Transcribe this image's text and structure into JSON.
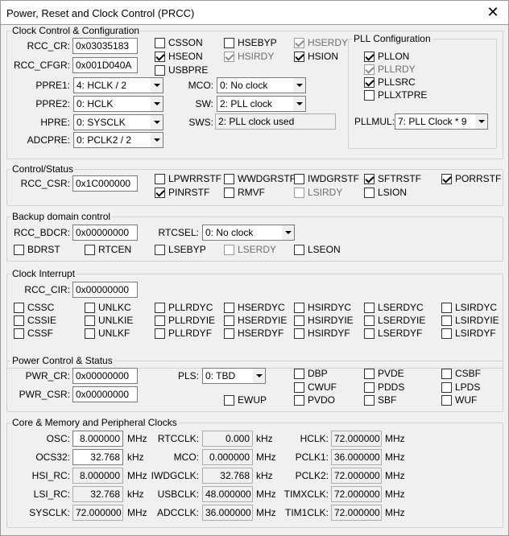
{
  "window": {
    "title": "Power, Reset and Clock Control (PRCC)",
    "close_glyph": "✕"
  },
  "ccc": {
    "legend": "Clock Control & Configuration",
    "rcc_cr_label": "RCC_CR:",
    "rcc_cr": "0x03035183",
    "rcc_cfgr_label": "RCC_CFGR:",
    "rcc_cfgr": "0x001D040A",
    "ppre1_label": "PPRE1:",
    "ppre1": "4: HCLK / 2",
    "ppre2_label": "PPRE2:",
    "ppre2": "0: HCLK",
    "hpre_label": "HPRE:",
    "hpre": "0: SYSCLK",
    "adcpre_label": "ADCPRE:",
    "adcpre": "0: PCLK2 / 2",
    "mco_label": "MCO:",
    "mco": "0: No clock",
    "sw_label": "SW:",
    "sw": "2: PLL clock",
    "sws_label": "SWS:",
    "sws": "2: PLL clock used",
    "checks": [
      {
        "label": "CSSON",
        "checked": false,
        "disabled": false
      },
      {
        "label": "HSEBYP",
        "checked": false,
        "disabled": false
      },
      {
        "label": "HSERDY",
        "checked": true,
        "disabled": true
      },
      {
        "label": "HSEON",
        "checked": true,
        "disabled": false
      },
      {
        "label": "HSIRDY",
        "checked": true,
        "disabled": true
      },
      {
        "label": "HSION",
        "checked": true,
        "disabled": false
      },
      {
        "label": "USBPRE",
        "checked": false,
        "disabled": false
      }
    ],
    "pll": {
      "legend": "PLL Configuration",
      "checks": [
        {
          "label": "PLLON",
          "checked": true,
          "disabled": false
        },
        {
          "label": "PLLRDY",
          "checked": true,
          "disabled": true
        },
        {
          "label": "PLLSRC",
          "checked": true,
          "disabled": false
        },
        {
          "label": "PLLXTPRE",
          "checked": false,
          "disabled": false
        }
      ],
      "pllmul_label": "PLLMUL:",
      "pllmul": "7: PLL Clock * 9"
    }
  },
  "cs": {
    "legend": "Control/Status",
    "rcc_csr_label": "RCC_CSR:",
    "rcc_csr": "0x1C000000",
    "checks": [
      {
        "label": "LPWRRSTF",
        "checked": false,
        "disabled": false
      },
      {
        "label": "WWDGRSTF",
        "checked": false,
        "disabled": false
      },
      {
        "label": "IWDGRSTF",
        "checked": false,
        "disabled": false
      },
      {
        "label": "SFTRSTF",
        "checked": true,
        "disabled": false
      },
      {
        "label": "PORRSTF",
        "checked": true,
        "disabled": false
      },
      {
        "label": "PINRSTF",
        "checked": true,
        "disabled": false
      },
      {
        "label": "RMVF",
        "checked": false,
        "disabled": false
      },
      {
        "label": "LSIRDY",
        "checked": false,
        "disabled": true
      },
      {
        "label": "LSION",
        "checked": false,
        "disabled": false
      }
    ]
  },
  "bdc": {
    "legend": "Backup domain control",
    "rcc_bdcr_label": "RCC_BDCR:",
    "rcc_bdcr": "0x00000000",
    "rtcsel_label": "RTCSEL:",
    "rtcsel": "0: No clock",
    "checks": [
      {
        "label": "BDRST",
        "checked": false,
        "disabled": false
      },
      {
        "label": "RTCEN",
        "checked": false,
        "disabled": false
      },
      {
        "label": "LSEBYP",
        "checked": false,
        "disabled": false
      },
      {
        "label": "LSERDY",
        "checked": false,
        "disabled": true
      },
      {
        "label": "LSEON",
        "checked": false,
        "disabled": false
      }
    ]
  },
  "ci": {
    "legend": "Clock Interrupt",
    "rcc_cir_label": "RCC_CIR:",
    "rcc_cir": "0x00000000",
    "checks": [
      {
        "label": "CSSC",
        "checked": false,
        "disabled": false
      },
      {
        "label": "UNLKC",
        "checked": false,
        "disabled": false
      },
      {
        "label": "PLLRDYC",
        "checked": false,
        "disabled": false
      },
      {
        "label": "HSERDYC",
        "checked": false,
        "disabled": false
      },
      {
        "label": "HSIRDYC",
        "checked": false,
        "disabled": false
      },
      {
        "label": "LSERDYC",
        "checked": false,
        "disabled": false
      },
      {
        "label": "LSIRDYC",
        "checked": false,
        "disabled": false
      },
      {
        "label": "CSSIE",
        "checked": false,
        "disabled": false
      },
      {
        "label": "UNLKIE",
        "checked": false,
        "disabled": false
      },
      {
        "label": "PLLRDYIE",
        "checked": false,
        "disabled": false
      },
      {
        "label": "HSERDYIE",
        "checked": false,
        "disabled": false
      },
      {
        "label": "HSIRDYIE",
        "checked": false,
        "disabled": false
      },
      {
        "label": "LSERDYIE",
        "checked": false,
        "disabled": false
      },
      {
        "label": "LSIRDYIE",
        "checked": false,
        "disabled": false
      },
      {
        "label": "CSSF",
        "checked": false,
        "disabled": false
      },
      {
        "label": "UNLKF",
        "checked": false,
        "disabled": false
      },
      {
        "label": "PLLRDYF",
        "checked": false,
        "disabled": false
      },
      {
        "label": "HSERDYF",
        "checked": false,
        "disabled": false
      },
      {
        "label": "HSIRDYF",
        "checked": false,
        "disabled": false
      },
      {
        "label": "LSERDYF",
        "checked": false,
        "disabled": false
      },
      {
        "label": "LSIRDYF",
        "checked": false,
        "disabled": false
      }
    ]
  },
  "pcs": {
    "legend": "Power Control & Status",
    "pwr_cr_label": "PWR_CR:",
    "pwr_cr": "0x00000000",
    "pwr_csr_label": "PWR_CSR:",
    "pwr_csr": "0x00000000",
    "pls_label": "PLS:",
    "pls": "0: TBD",
    "checks": [
      {
        "label": "EWUP",
        "checked": false,
        "disabled": false
      },
      {
        "label": "DBP",
        "checked": false,
        "disabled": false
      },
      {
        "label": "PVDE",
        "checked": false,
        "disabled": false
      },
      {
        "label": "CSBF",
        "checked": false,
        "disabled": false
      },
      {
        "label": "CWUF",
        "checked": false,
        "disabled": false
      },
      {
        "label": "PDDS",
        "checked": false,
        "disabled": false
      },
      {
        "label": "LPDS",
        "checked": false,
        "disabled": false
      },
      {
        "label": "PVDO",
        "checked": false,
        "disabled": false
      },
      {
        "label": "SBF",
        "checked": false,
        "disabled": false
      },
      {
        "label": "WUF",
        "checked": false,
        "disabled": false
      }
    ]
  },
  "cmp": {
    "legend": "Core & Memory and Peripheral Clocks",
    "rows": [
      {
        "label": "OSC:",
        "value": "8.000000",
        "unit": "MHz",
        "editable": true
      },
      {
        "label": "OCS32:",
        "value": "32.768",
        "unit": "kHz",
        "editable": true
      },
      {
        "label": "HSI_RC:",
        "value": "8.000000",
        "unit": "MHz",
        "editable": false
      },
      {
        "label": "LSI_RC:",
        "value": "32.768",
        "unit": "kHz",
        "editable": false
      },
      {
        "label": "SYSCLK:",
        "value": "72.000000",
        "unit": "MHz",
        "editable": false
      },
      {
        "label": "RTCCLK:",
        "value": "0.000",
        "unit": "kHz",
        "editable": false
      },
      {
        "label": "MCO:",
        "value": "0.000000",
        "unit": "MHz",
        "editable": false
      },
      {
        "label": "IWDGCLK:",
        "value": "32.768",
        "unit": "kHz",
        "editable": false
      },
      {
        "label": "USBCLK:",
        "value": "48.000000",
        "unit": "MHz",
        "editable": false
      },
      {
        "label": "ADCCLK:",
        "value": "36.000000",
        "unit": "MHz",
        "editable": false
      },
      {
        "label": "HCLK:",
        "value": "72.000000",
        "unit": "MHz",
        "editable": false
      },
      {
        "label": "PCLK1:",
        "value": "36.000000",
        "unit": "MHz",
        "editable": false
      },
      {
        "label": "PCLK2:",
        "value": "72.000000",
        "unit": "MHz",
        "editable": false
      },
      {
        "label": "TIMXCLK:",
        "value": "72.000000",
        "unit": "MHz",
        "editable": false
      },
      {
        "label": "TIM1CLK:",
        "value": "72.000000",
        "unit": "MHz",
        "editable": false
      }
    ]
  }
}
